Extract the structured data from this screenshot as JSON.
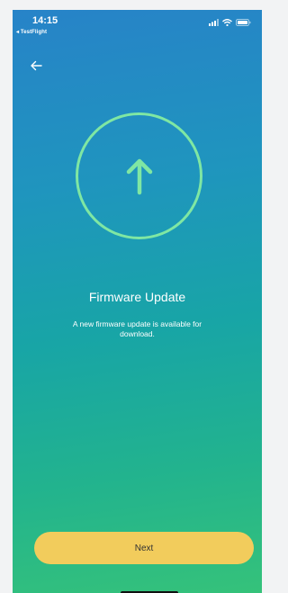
{
  "status_bar": {
    "time": "14:15",
    "back_app": "◂ TestFlight",
    "icons": [
      "signal-icon",
      "wifi-icon",
      "battery-icon"
    ]
  },
  "nav": {
    "back_icon": "arrow-left-icon"
  },
  "hero": {
    "icon": "arrow-up-icon",
    "ring_color": "#7fe7a3"
  },
  "content": {
    "title": "Firmware Update",
    "message": "A new firmware update is available for download."
  },
  "actions": {
    "next_label": "Next",
    "button_color": "#f2cc5c"
  },
  "colors": {
    "gradient_top": "#2783c8",
    "gradient_bottom": "#35c27a"
  }
}
